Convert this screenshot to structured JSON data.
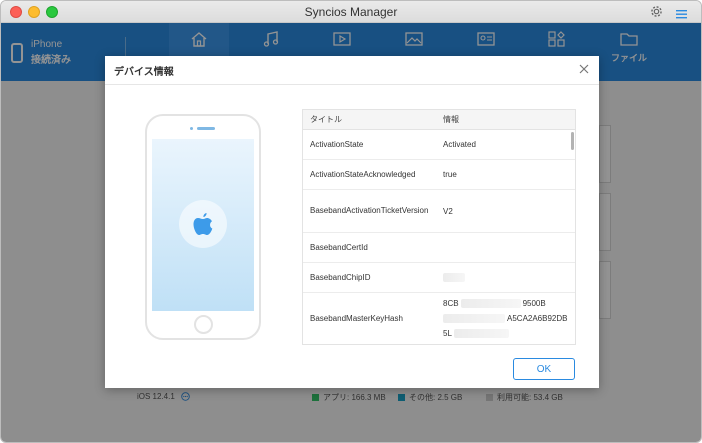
{
  "window": {
    "title": "Syncios Manager"
  },
  "device": {
    "name": "iPhone",
    "status": "接続済み"
  },
  "nav": {
    "items": [
      {
        "icon": "home-icon",
        "label": ""
      },
      {
        "icon": "music-icon",
        "label": ""
      },
      {
        "icon": "video-icon",
        "label": ""
      },
      {
        "icon": "photo-icon",
        "label": ""
      },
      {
        "icon": "contact-icon",
        "label": ""
      },
      {
        "icon": "apps-icon",
        "label": ""
      },
      {
        "icon": "folder-icon",
        "label": "ファイル"
      }
    ]
  },
  "footer": {
    "ios_version": "iOS 12.4.1",
    "legend": [
      {
        "label": "アプリ: 166.3 MB",
        "color": "#35c46a"
      },
      {
        "label": "その他: 2.5 GB",
        "color": "#1aa3c7"
      },
      {
        "label": "利用可能: 53.4 GB",
        "color": "#cccccc"
      }
    ]
  },
  "dialog": {
    "title": "デバイス情報",
    "ok_label": "OK",
    "table": {
      "headers": {
        "title": "タイトル",
        "info": "情報"
      },
      "rows": [
        {
          "title": "ActivationState",
          "value": "Activated"
        },
        {
          "title": "ActivationStateAcknowledged",
          "value": "true"
        },
        {
          "title": "BasebandActivationTicketVersion",
          "value": "V2"
        },
        {
          "title": "BasebandCertId",
          "value": ""
        },
        {
          "title": "BasebandChipID",
          "value": ""
        },
        {
          "title": "BasebandMasterKeyHash",
          "value_lines": [
            "8CB",
            "9500B",
            "A5CA2A6B92DB",
            "5L"
          ]
        }
      ]
    }
  },
  "colors": {
    "accent": "#2a8ae0"
  }
}
